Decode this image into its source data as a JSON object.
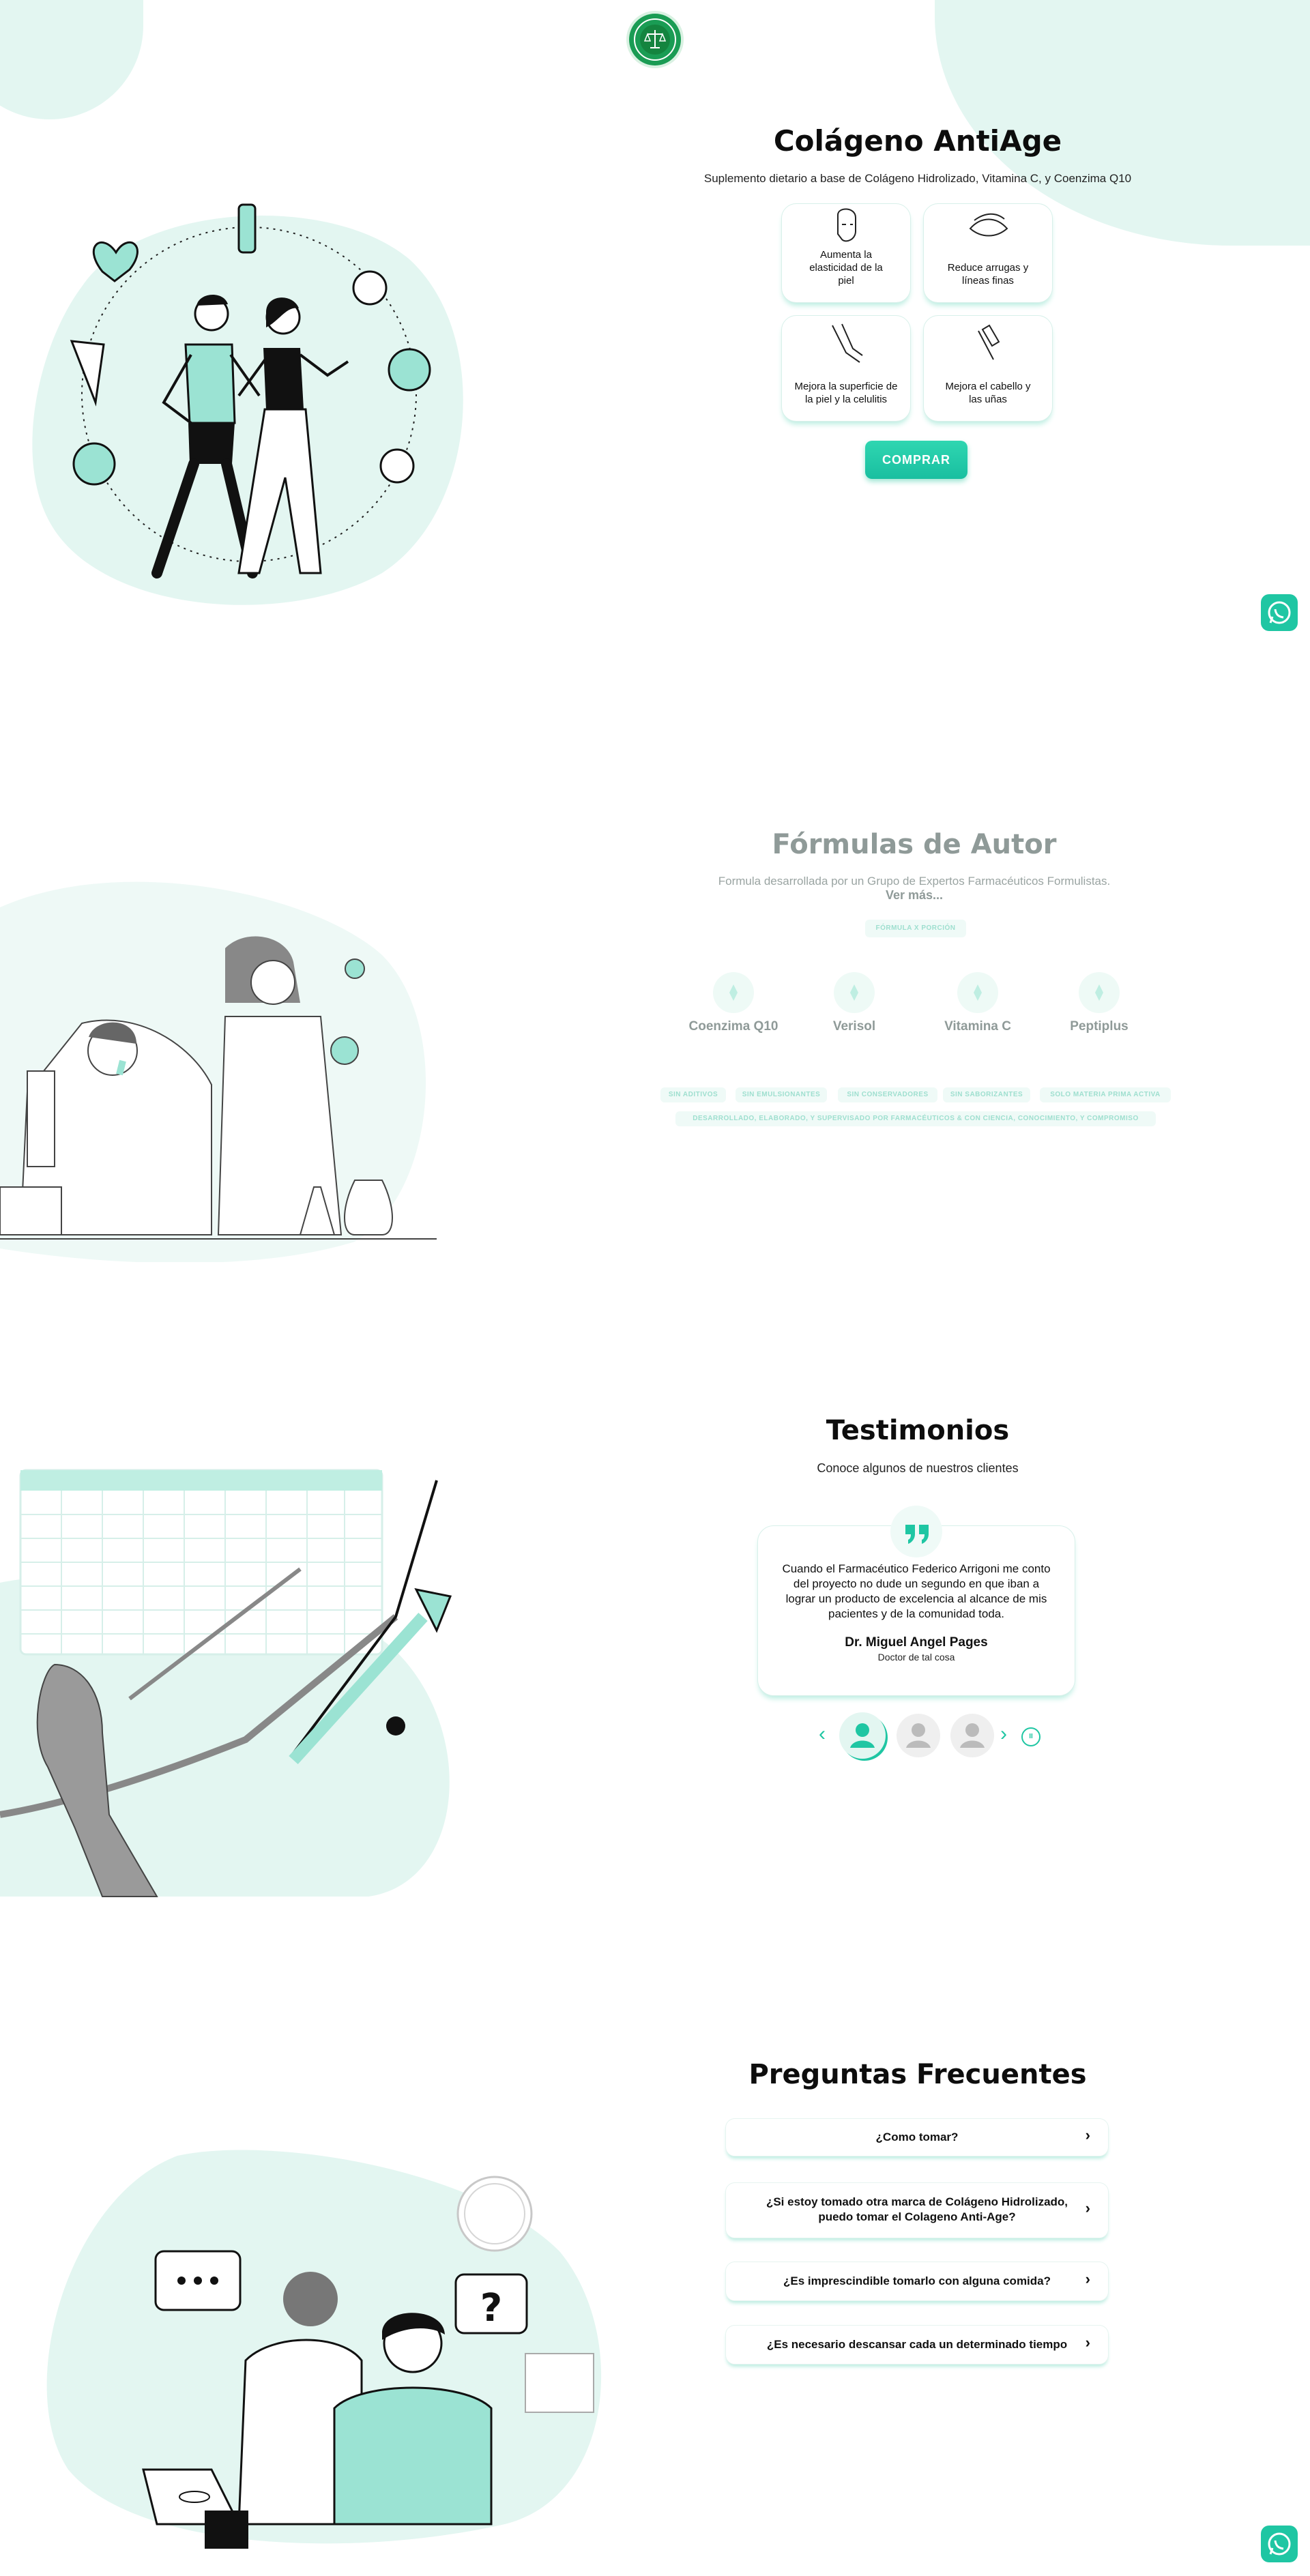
{
  "colors": {
    "accent": "#1fc6a3",
    "accent_light": "#e3f6f1",
    "text": "#0d0d0d",
    "muted": "#8f9a98"
  },
  "header": {
    "logo_icon": "scales-of-justice-seal-icon"
  },
  "hero": {
    "title": "Colágeno AntiAge",
    "subtitle": "Suplemento dietario a base de Colágeno Hidrolizado, Vitamina C, y Coenzima Q10",
    "benefits": [
      {
        "label": "Aumenta la elasticidad de la piel",
        "icon": "woman-face-icon"
      },
      {
        "label": "Reduce arrugas y líneas finas",
        "icon": "eye-wrinkles-icon"
      },
      {
        "label": "Mejora la superficie de la piel y la celulitis",
        "icon": "leg-skin-icon"
      },
      {
        "label": "Mejora el cabello y las uñas",
        "icon": "nail-polish-icon"
      }
    ],
    "buy_label": "COMPRAR"
  },
  "whatsapp": {
    "icon": "whatsapp-icon"
  },
  "formulas": {
    "title": "Fórmulas de Autor",
    "subtitle": "Formula desarrollada por un Grupo de Expertos Farmacéuticos Formulistas.",
    "more_label": "Ver más...",
    "tab_label": "FÓRMULA X PORCIÓN",
    "ingredients": [
      {
        "label": "Coenzima Q10",
        "icon": "molecule-icon"
      },
      {
        "label": "Verisol",
        "icon": "molecule-icon"
      },
      {
        "label": "Vitamina C",
        "icon": "molecule-icon"
      },
      {
        "label": "Peptiplus",
        "icon": "molecule-icon"
      }
    ],
    "tags": [
      "SIN ADITIVOS",
      "SIN EMULSIONANTES",
      "SIN CONSERVADORES",
      "SIN SABORIZANTES",
      "SOLO MATERIA PRIMA ACTIVA"
    ],
    "footer_tag": "DESARROLLADO, ELABORADO, Y SUPERVISADO POR FARMACÉUTICOS & CON CIENCIA, CONOCIMIENTO, Y COMPROMISO"
  },
  "testimonials": {
    "title": "Testimonios",
    "subtitle": "Conoce algunos de nuestros clientes",
    "quote_icon": "quote-icon",
    "quote": "Cuando el Farmacéutico Federico Arrigoni me conto del proyecto no dude un segundo en que iban a lograr un producto de excelencia al alcance de mis pacientes y de la comunidad toda.",
    "author": "Dr. Miguel Angel Pages",
    "role": "Doctor de tal cosa",
    "prev_label": "‹",
    "next_label": "›",
    "pause_label": "II"
  },
  "faq": {
    "title": "Preguntas Frecuentes",
    "items": [
      {
        "question": "¿Como tomar?"
      },
      {
        "question": "¿Si estoy tomado otra marca de Colágeno Hidrolizado, puedo tomar el Colageno Anti-Age?"
      },
      {
        "question": "¿Es imprescindible tomarlo con alguna comida?"
      },
      {
        "question": "¿Es necesario descansar cada un determinado tiempo"
      }
    ],
    "chevron": "›"
  }
}
